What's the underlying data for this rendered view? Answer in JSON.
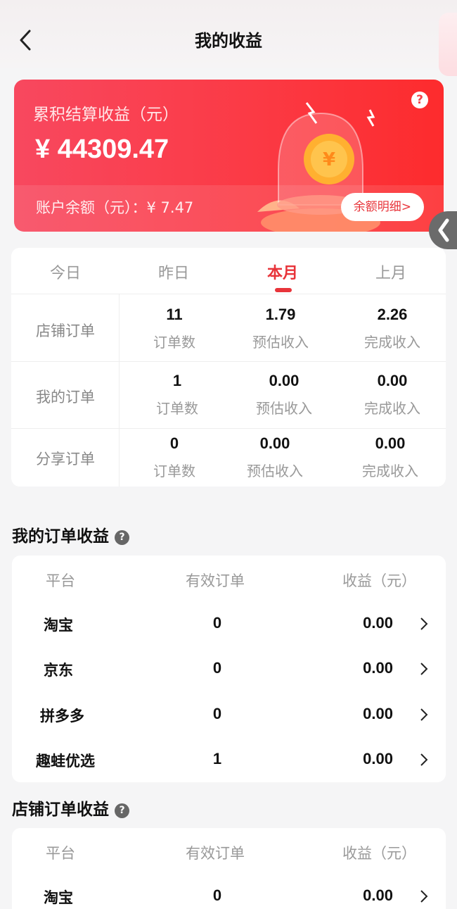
{
  "header": {
    "title": "我的收益"
  },
  "card": {
    "label": "累积结算收益（元）",
    "total": "¥ 44309.47",
    "balance": "账户余额（元）：¥ 7.47",
    "help": "?",
    "detail_button": "余额明细>"
  },
  "stats": {
    "tabs": [
      "今日",
      "昨日",
      "本月",
      "上月"
    ],
    "active_tab": "本月",
    "rows": [
      {
        "label": "店铺订单",
        "cells": [
          {
            "value": "11",
            "caption": "订单数"
          },
          {
            "value": "1.79",
            "caption": "预估收入"
          },
          {
            "value": "2.26",
            "caption": "完成收入"
          }
        ]
      },
      {
        "label": "我的订单",
        "cells": [
          {
            "value": "1",
            "caption": "订单数"
          },
          {
            "value": "0.00",
            "caption": "预估收入"
          },
          {
            "value": "0.00",
            "caption": "完成收入"
          }
        ]
      },
      {
        "label": "分享订单",
        "cells": [
          {
            "value": "0",
            "caption": "订单数"
          },
          {
            "value": "0.00",
            "caption": "预估收入"
          },
          {
            "value": "0.00",
            "caption": "完成收入"
          }
        ]
      }
    ]
  },
  "my_orders": {
    "title": "我的订单收益",
    "headers": [
      "平台",
      "有效订单",
      "收益（元）"
    ],
    "rows": [
      {
        "platform": "淘宝",
        "count": "0",
        "amount": "0.00"
      },
      {
        "platform": "京东",
        "count": "0",
        "amount": "0.00"
      },
      {
        "platform": "拼多多",
        "count": "0",
        "amount": "0.00"
      },
      {
        "platform": "趣蛙优选",
        "count": "1",
        "amount": "0.00"
      }
    ]
  },
  "shop_orders": {
    "title": "店铺订单收益",
    "headers": [
      "平台",
      "有效订单",
      "收益（元）"
    ],
    "rows": [
      {
        "platform": "淘宝",
        "count": "0",
        "amount": "0.00"
      }
    ]
  },
  "colors": {
    "accent": "#e8343a",
    "card_start": "#f8485f",
    "card_end": "#fd2b2d"
  }
}
